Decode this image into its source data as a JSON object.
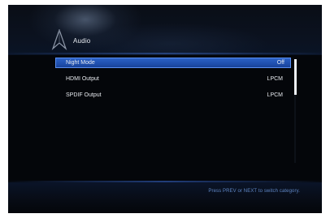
{
  "header": {
    "title": "Audio",
    "icon": "audio-category-icon"
  },
  "menu": {
    "items": [
      {
        "label": "Night Mode",
        "value": "Off",
        "selected": true
      },
      {
        "label": "HDMI Output",
        "value": "LPCM",
        "selected": false
      },
      {
        "label": "SPDIF Output",
        "value": "LPCM",
        "selected": false
      }
    ]
  },
  "footer": {
    "hint": "Press PREV or NEXT to switch category."
  },
  "colors": {
    "selection": "#2a5fc4",
    "hint_text": "#5f86c4",
    "background": "#04060a"
  }
}
